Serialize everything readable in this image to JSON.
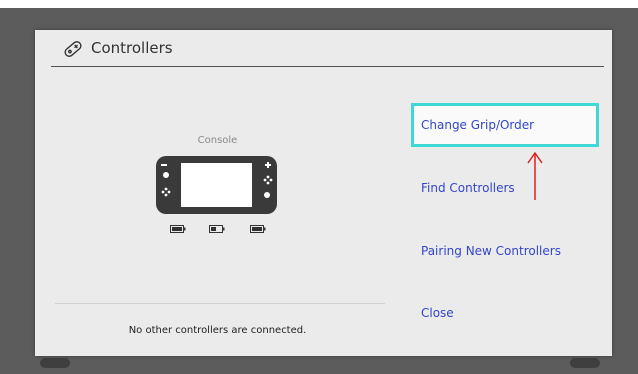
{
  "header": {
    "title": "Controllers",
    "icon": "controller-icon"
  },
  "console": {
    "label": "Console",
    "status": "No other controllers are connected."
  },
  "menu": {
    "items": [
      {
        "label": "Change Grip/Order",
        "selected": true
      },
      {
        "label": "Find Controllers",
        "selected": false
      },
      {
        "label": "Pairing New Controllers",
        "selected": false
      },
      {
        "label": "Close",
        "selected": false
      }
    ]
  },
  "colors": {
    "accent": "#3ed8d6",
    "link": "#3346c8",
    "annotation_arrow": "#e02020",
    "panel": "#ebebeb"
  }
}
